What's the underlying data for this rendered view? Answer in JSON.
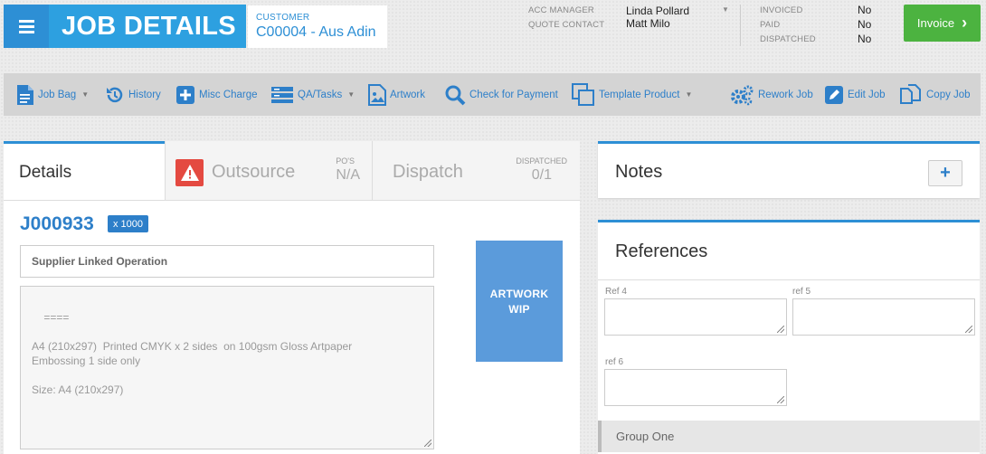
{
  "header": {
    "title": "JOB DETAILS",
    "customer_label": "CUSTOMER",
    "customer_value": "C00004 - Aus Adin",
    "acc_manager_label": "ACC MANAGER",
    "acc_manager_value": "Linda Pollard",
    "quote_contact_label": "QUOTE CONTACT",
    "quote_contact_value": "Matt Milo",
    "invoiced_label": "INVOICED",
    "invoiced_value": "No",
    "paid_label": "PAID",
    "paid_value": "No",
    "dispatched_label": "DISPATCHED",
    "dispatched_value": "No",
    "invoice_button": "Invoice"
  },
  "toolbar": {
    "job_bag": "Job Bag",
    "history": "History",
    "misc_charge": "Misc Charge",
    "qa_tasks": "QA/Tasks",
    "artwork": "Artwork",
    "check_payment": "Check for Payment",
    "template_product": "Template Product",
    "rework_job": "Rework Job",
    "edit_job": "Edit Job",
    "copy_job": "Copy Job"
  },
  "tabs": {
    "details": "Details",
    "outsource": "Outsource",
    "pos_label": "PO'S",
    "pos_value": "N/A",
    "dispatch": "Dispatch",
    "dispatched_label": "DISPATCHED",
    "dispatched_value": "0/1"
  },
  "details": {
    "job_number": "J000933",
    "quantity_badge": "x 1000",
    "supplier_placeholder": "Supplier Linked Operation",
    "description": "====\n\nA4 (210x297)  Printed CMYK x 2 sides  on 100gsm Gloss Artpaper\nEmbossing 1 side only\n\nSize: A4 (210x297)",
    "artwork_status_line1": "ARTWORK",
    "artwork_status_line2": "WIP"
  },
  "notes": {
    "title": "Notes",
    "add_label": "+"
  },
  "references": {
    "title": "References",
    "ref4_label": "Ref 4",
    "ref5_label": "ref 5",
    "ref6_label": "ref 6",
    "group_label": "Group One"
  },
  "colors": {
    "primary": "#2d8fd5",
    "title_bg": "#2da0e0",
    "invoice_green": "#4cb340",
    "warning_red": "#e44a41",
    "artwork_blue": "#5b9bdb"
  }
}
